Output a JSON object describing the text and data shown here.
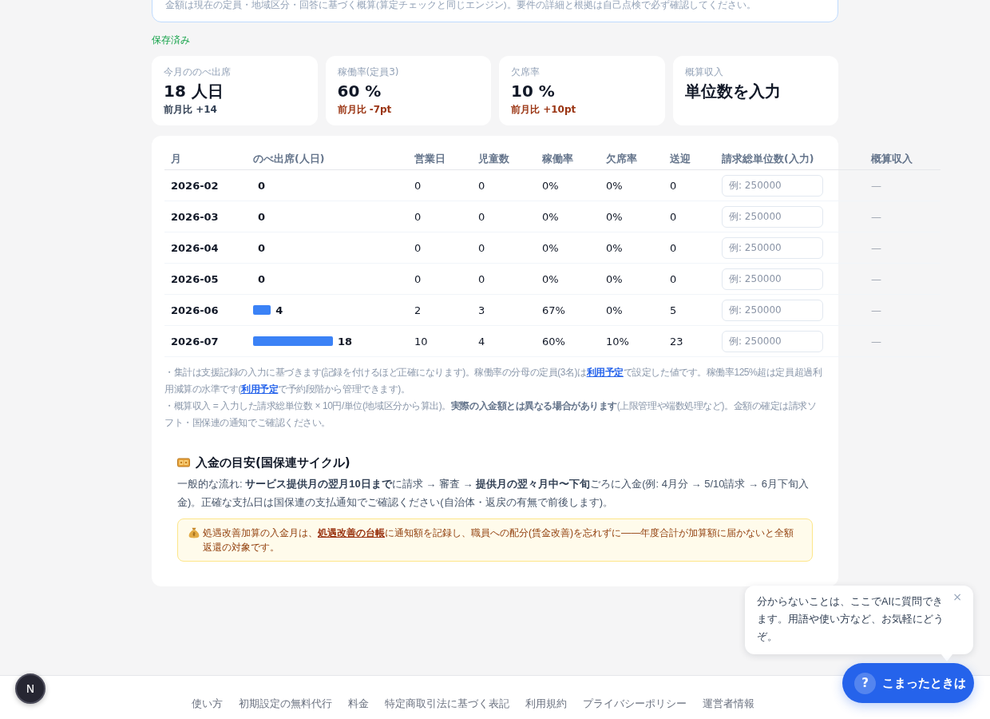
{
  "notice": "金額は現在の定員・地域区分・回答に基づく概算(算定チェックと同じエンジン)。要件の詳細と根拠は自己点検で必ず確認してください。",
  "save_status": "保存済み",
  "stats": [
    {
      "label": "今月ののべ出席",
      "value": "18 人日",
      "change": "前月比 +14",
      "alert": false
    },
    {
      "label": "稼働率(定員3)",
      "value": "60 %",
      "change": "前月比 -7pt",
      "alert": true
    },
    {
      "label": "欠席率",
      "value": "10 %",
      "change": "前月比 +10pt",
      "alert": true
    },
    {
      "label": "概算収入",
      "value": "単位数を入力"
    }
  ],
  "table": {
    "columns": [
      "月",
      "のべ出席(人日)",
      "営業日",
      "児童数",
      "稼働率",
      "欠席率",
      "送迎",
      "請求総単位数(入力)",
      "概算収入"
    ],
    "rows": [
      {
        "month": "2026-02",
        "attendance": "0",
        "business_days": "0",
        "children": "0",
        "utilization": "0%",
        "absence": "0%",
        "transport": "0",
        "units_placeholder": "例: 250000",
        "estimate": "—"
      },
      {
        "month": "2026-03",
        "attendance": "0",
        "business_days": "0",
        "children": "0",
        "utilization": "0%",
        "absence": "0%",
        "transport": "0",
        "units_placeholder": "例: 250000",
        "estimate": "—"
      },
      {
        "month": "2026-04",
        "attendance": "0",
        "business_days": "0",
        "children": "0",
        "utilization": "0%",
        "absence": "0%",
        "transport": "0",
        "units_placeholder": "例: 250000",
        "estimate": "—"
      },
      {
        "month": "2026-05",
        "attendance": "0",
        "business_days": "0",
        "children": "0",
        "utilization": "0%",
        "absence": "0%",
        "transport": "0",
        "units_placeholder": "例: 250000",
        "estimate": "—"
      },
      {
        "month": "2026-06",
        "attendance": "4",
        "business_days": "2",
        "children": "3",
        "utilization": "67%",
        "absence": "0%",
        "transport": "5",
        "units_placeholder": "例: 250000",
        "estimate": "—"
      },
      {
        "month": "2026-07",
        "attendance": "18",
        "business_days": "10",
        "children": "4",
        "utilization": "60%",
        "absence": "10%",
        "transport": "23",
        "units_placeholder": "例: 250000",
        "estimate": "—"
      }
    ]
  },
  "notes": [
    {
      "segments": [
        {
          "kind": "text",
          "text": "・集計は支援記録の入力に基づきます(記録を付けるほど正確になります)。稼働率の分母の定員(3名)は"
        },
        {
          "kind": "link",
          "text": "利用予定"
        },
        {
          "kind": "text",
          "text": "で設定した値です。稼働率125%超は定員超過利用減算の水準です("
        },
        {
          "kind": "link",
          "text": "利用予定"
        },
        {
          "kind": "text",
          "text": "で予約段階から管理できます)。"
        }
      ]
    },
    {
      "segments": [
        {
          "kind": "text",
          "text": "・概算収入 = 入力した請求総単位数 × 10円/単位(地域区分から算出)。**実際の入金額とは異なる場合があります**(上限管理や端数処理など)。金額の確定は請求ソフト・国保連の通知でご確認ください。"
        }
      ]
    }
  ],
  "payment_cycle": {
    "title": "入金の目安(国保連サイクル)",
    "text": "一般的な流れ: **サービス提供月の翌月10日まで**に請求 → 審査 → **提供月の翌々月中〜下旬**ごろに入金(例: 4月分 → 5/10請求 → 6月下旬入金)。正確な支払日は国保連の支払通知でご確認ください(自治体・返戻の有無で前後します)。",
    "warning": {
      "segments": [
        {
          "kind": "text",
          "text": "処遇改善加算の入金月は、"
        },
        {
          "kind": "link",
          "text": "処遇改善の台帳"
        },
        {
          "kind": "text",
          "text": "に通知額を記録し、職員への配分(賃金改善)を忘れずに——年度合計が加算額に届かないと全額返還の対象です。"
        }
      ]
    }
  },
  "footer_links": [
    "使い方",
    "初期設定の無料代行",
    "料金",
    "特定商取引法に基づく表記",
    "利用規約",
    "プライバシーポリシー",
    "運営者情報"
  ],
  "help_tip": {
    "text": "分からないことは、ここでAIに質問できます。用語や使い方など、お気軽にどうぞ。",
    "close": "×"
  },
  "help_button": {
    "icon": "?",
    "label": "こまったときは"
  },
  "dev_badge": {
    "label": "N"
  }
}
